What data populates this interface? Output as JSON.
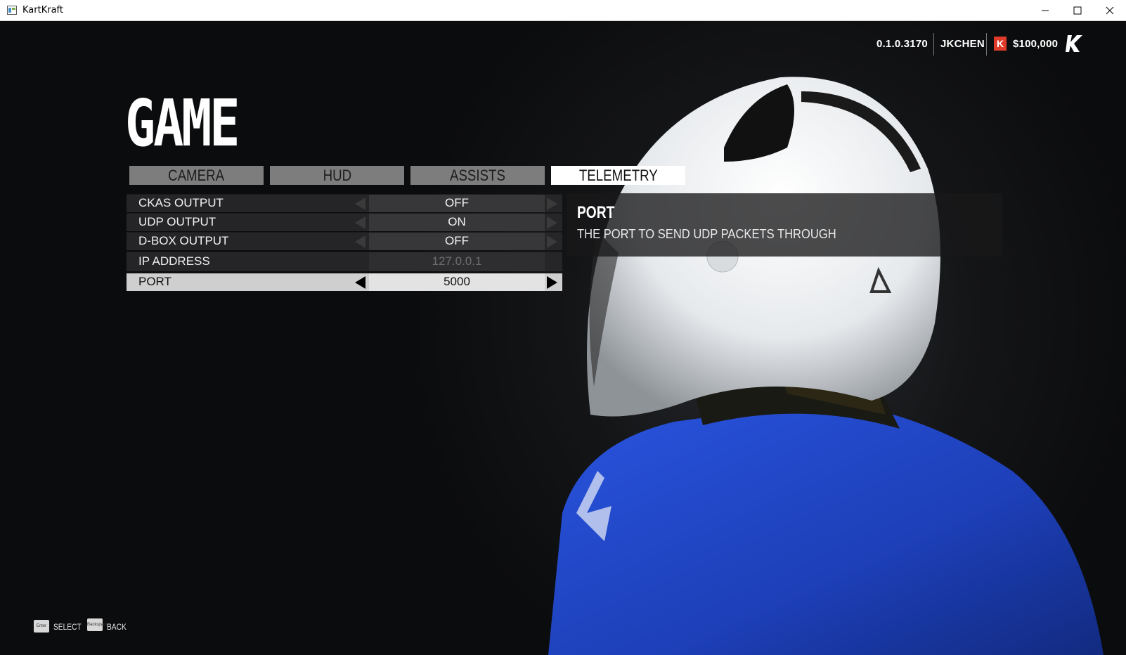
{
  "window": {
    "title": "KartKraft",
    "controls": [
      "minimize",
      "maximize",
      "close"
    ]
  },
  "top_info": {
    "version": "0.1.0.3170",
    "user": "JKCHEN",
    "currency_badge": "K",
    "money": "$100,000",
    "logo": "kartkraft-logo-icon"
  },
  "page": {
    "title": "GAME"
  },
  "tabs": [
    {
      "label": "CAMERA",
      "active": false
    },
    {
      "label": "HUD",
      "active": false
    },
    {
      "label": "ASSISTS",
      "active": false
    },
    {
      "label": "TELEMETRY",
      "active": true
    }
  ],
  "settings": [
    {
      "label": "CKAS OUTPUT",
      "value": "OFF",
      "selected": false,
      "editable": true
    },
    {
      "label": "UDP OUTPUT",
      "value": "ON",
      "selected": false,
      "editable": true
    },
    {
      "label": "D-BOX OUTPUT",
      "value": "OFF",
      "selected": false,
      "editable": true
    },
    {
      "label": "IP ADDRESS",
      "value": "127.0.0.1",
      "selected": false,
      "editable": false
    },
    {
      "label": "PORT",
      "value": "5000",
      "selected": true,
      "editable": true
    }
  ],
  "description": {
    "title": "PORT",
    "text": "THE PORT TO SEND UDP PACKETS THROUGH"
  },
  "footer": {
    "hints": [
      {
        "key": "Enter",
        "label": "SELECT"
      },
      {
        "key": "Backspace",
        "label": "BACK"
      }
    ]
  },
  "colors": {
    "background": "#0c0d0f",
    "tab_inactive": "#7d7d7d",
    "tab_active": "#ffffff",
    "row_bg": "#28282a",
    "row_selected": "#cfcfcf",
    "currency_badge": "#e03a28",
    "suit_blue": "#1f45c8",
    "helmet_white": "#f4f6f8"
  }
}
